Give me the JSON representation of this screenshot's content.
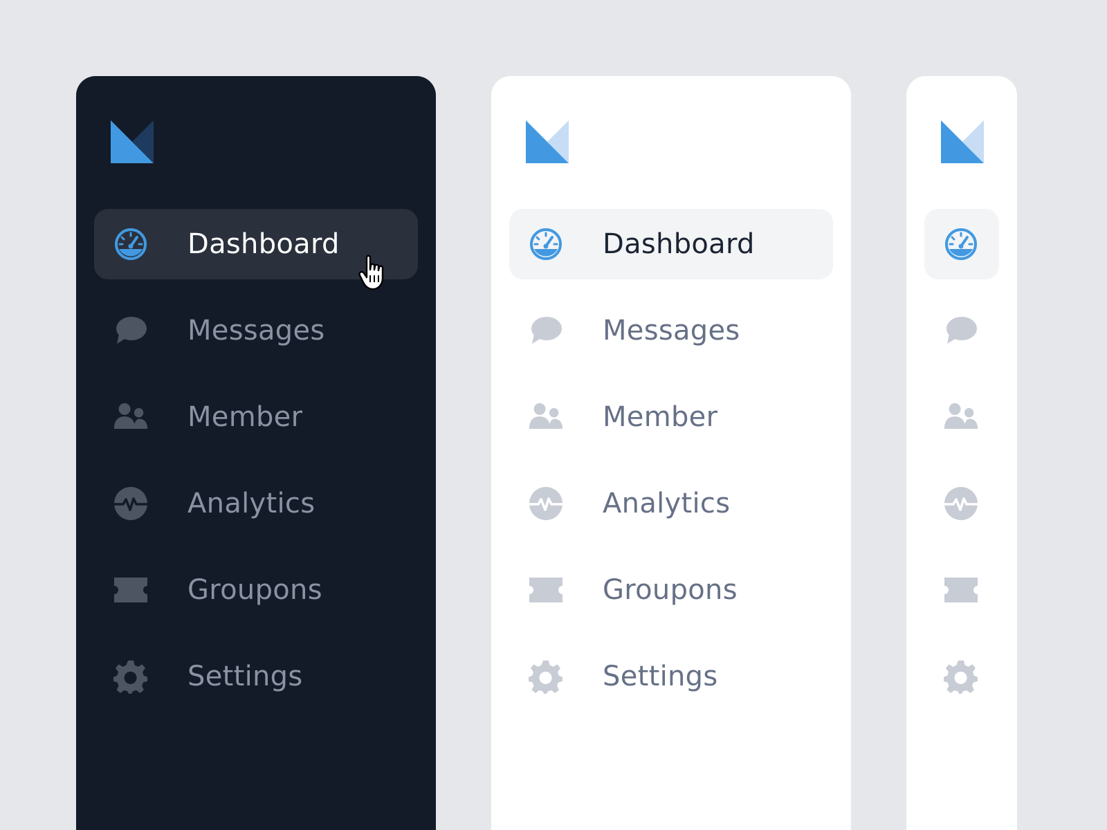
{
  "colors": {
    "background": "#e5e7ea",
    "dark_panel": "#131a28",
    "light_panel": "#ffffff",
    "accent": "#4299e1",
    "logo_secondary_dark": "#1e3a5f",
    "logo_secondary_light": "#c7ddf5",
    "icon_dark": "#4d5563",
    "icon_light": "#c7ccd5"
  },
  "nav": {
    "items": [
      {
        "label": "Dashboard",
        "icon": "dashboard-gauge-icon",
        "active": true
      },
      {
        "label": "Messages",
        "icon": "chat-bubble-icon",
        "active": false
      },
      {
        "label": "Member",
        "icon": "users-icon",
        "active": false
      },
      {
        "label": "Analytics",
        "icon": "pulse-icon",
        "active": false
      },
      {
        "label": "Groupons",
        "icon": "ticket-icon",
        "active": false
      },
      {
        "label": "Settings",
        "icon": "gear-icon",
        "active": false
      }
    ]
  }
}
